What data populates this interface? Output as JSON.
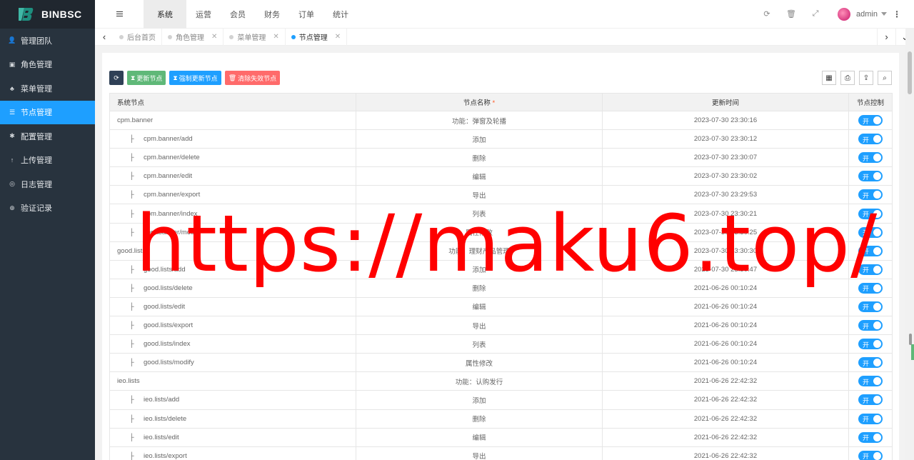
{
  "app": {
    "logo_text": "BINBSC"
  },
  "sidebar": {
    "items": [
      {
        "label": "管理团队",
        "icon": "user-icon",
        "glyph": "👤",
        "active": false
      },
      {
        "label": "角色管理",
        "icon": "role-icon",
        "glyph": "▣",
        "active": false
      },
      {
        "label": "菜单管理",
        "icon": "tree-icon",
        "glyph": "♣",
        "active": false
      },
      {
        "label": "节点管理",
        "icon": "list-icon",
        "glyph": "☰",
        "active": true
      },
      {
        "label": "配置管理",
        "icon": "asterisk-icon",
        "glyph": "✱",
        "active": false
      },
      {
        "label": "上传管理",
        "icon": "upload-arrow-icon",
        "glyph": "↑",
        "active": false
      },
      {
        "label": "日志管理",
        "icon": "log-icon",
        "glyph": "◎",
        "active": false
      },
      {
        "label": "验证记录",
        "icon": "verify-icon",
        "glyph": "⊕",
        "active": false
      }
    ]
  },
  "topnav": {
    "items": [
      "系统",
      "运营",
      "会员",
      "财务",
      "订单",
      "统计"
    ],
    "active_index": 0
  },
  "header": {
    "user": "admin"
  },
  "tabs": [
    {
      "label": "后台首页",
      "closable": false,
      "active": false
    },
    {
      "label": "角色管理",
      "closable": true,
      "active": false
    },
    {
      "label": "菜单管理",
      "closable": true,
      "active": false
    },
    {
      "label": "节点管理",
      "closable": true,
      "active": true
    }
  ],
  "toolbar": {
    "update_label": "更新节点",
    "force_update_label": "强制更新节点",
    "clear_label": "清除失效节点"
  },
  "table": {
    "headers": {
      "node": "系统节点",
      "name": "节点名称",
      "name_required": "*",
      "time": "更新时间",
      "control": "节点控制"
    },
    "switch_label": "开",
    "rows": [
      {
        "node": "cpm.banner",
        "child": false,
        "name": "功能：弹窗及轮播",
        "time": "2023-07-30 23:30:16"
      },
      {
        "node": "cpm.banner/add",
        "child": true,
        "name": "添加",
        "time": "2023-07-30 23:30:12"
      },
      {
        "node": "cpm.banner/delete",
        "child": true,
        "name": "删除",
        "time": "2023-07-30 23:30:07"
      },
      {
        "node": "cpm.banner/edit",
        "child": true,
        "name": "编辑",
        "time": "2023-07-30 23:30:02"
      },
      {
        "node": "cpm.banner/export",
        "child": true,
        "name": "导出",
        "time": "2023-07-30 23:29:53"
      },
      {
        "node": "cpm.banner/index",
        "child": true,
        "name": "列表",
        "time": "2023-07-30 23:30:21"
      },
      {
        "node": "cpm.banner/modify",
        "child": true,
        "name": "属性修改",
        "time": "2023-07-30 23:30:25"
      },
      {
        "node": "good.lists",
        "child": false,
        "name": "功能：理财产品管理",
        "time": "2023-07-30 23:30:30"
      },
      {
        "node": "good.lists/add",
        "child": true,
        "name": "添加",
        "time": "2023-07-30 23:30:47"
      },
      {
        "node": "good.lists/delete",
        "child": true,
        "name": "删除",
        "time": "2021-06-26 00:10:24"
      },
      {
        "node": "good.lists/edit",
        "child": true,
        "name": "编辑",
        "time": "2021-06-26 00:10:24"
      },
      {
        "node": "good.lists/export",
        "child": true,
        "name": "导出",
        "time": "2021-06-26 00:10:24"
      },
      {
        "node": "good.lists/index",
        "child": true,
        "name": "列表",
        "time": "2021-06-26 00:10:24"
      },
      {
        "node": "good.lists/modify",
        "child": true,
        "name": "属性修改",
        "time": "2021-06-26 00:10:24"
      },
      {
        "node": "ieo.lists",
        "child": false,
        "name": "功能：认购发行",
        "time": "2021-06-26 22:42:32"
      },
      {
        "node": "ieo.lists/add",
        "child": true,
        "name": "添加",
        "time": "2021-06-26 22:42:32"
      },
      {
        "node": "ieo.lists/delete",
        "child": true,
        "name": "删除",
        "time": "2021-06-26 22:42:32"
      },
      {
        "node": "ieo.lists/edit",
        "child": true,
        "name": "编辑",
        "time": "2021-06-26 22:42:32"
      },
      {
        "node": "ieo.lists/export",
        "child": true,
        "name": "导出",
        "time": "2021-06-26 22:42:32"
      }
    ]
  },
  "watermark": "https://maku6.top/",
  "colors": {
    "accent": "#1e9fff",
    "sidebar_bg": "#28333e",
    "green": "#5fb878",
    "red": "#ff6b6b",
    "dark": "#2f4056",
    "watermark": "#ff0000"
  }
}
